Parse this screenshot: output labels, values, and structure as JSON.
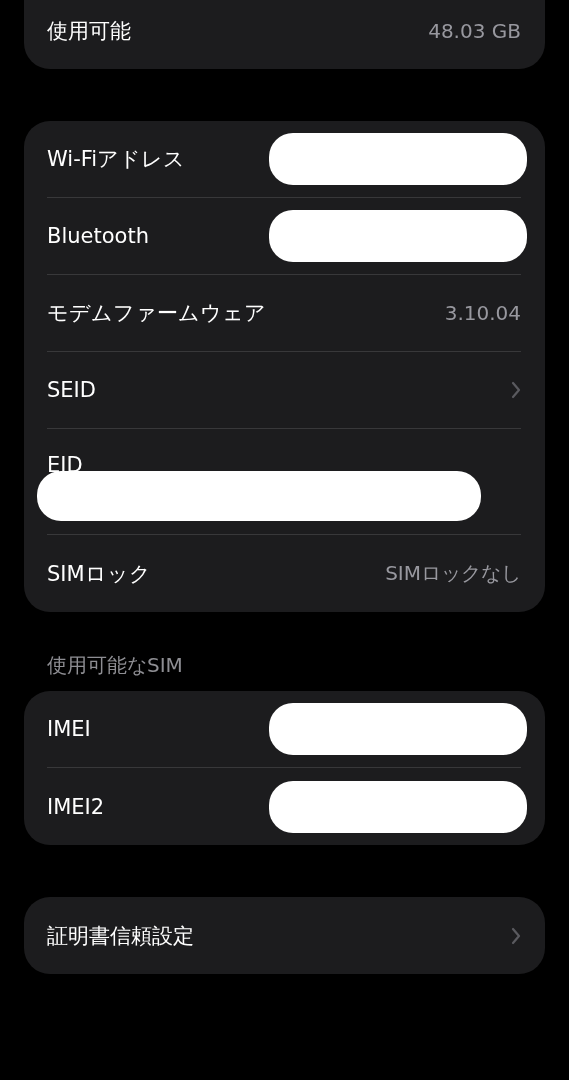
{
  "sections": [
    {
      "cut_top": true,
      "rows": [
        {
          "kind": "value",
          "label": "使用可能",
          "value": "48.03 GB"
        }
      ]
    },
    {
      "rows": [
        {
          "kind": "redacted",
          "label": "Wi-Fiアドレス"
        },
        {
          "kind": "redacted",
          "label": "Bluetooth"
        },
        {
          "kind": "value",
          "label": "モデムファームウェア",
          "value": "3.10.04"
        },
        {
          "kind": "chevron",
          "label": "SEID"
        },
        {
          "kind": "stacked_redacted",
          "label": "EID"
        },
        {
          "kind": "value",
          "label": "SIMロック",
          "value": "SIMロックなし"
        }
      ]
    },
    {
      "header": "使用可能なSIM",
      "rows": [
        {
          "kind": "redacted",
          "label": "IMEI"
        },
        {
          "kind": "redacted",
          "label": "IMEI2"
        }
      ]
    },
    {
      "rows": [
        {
          "kind": "chevron",
          "label": "証明書信頼設定"
        }
      ]
    }
  ]
}
